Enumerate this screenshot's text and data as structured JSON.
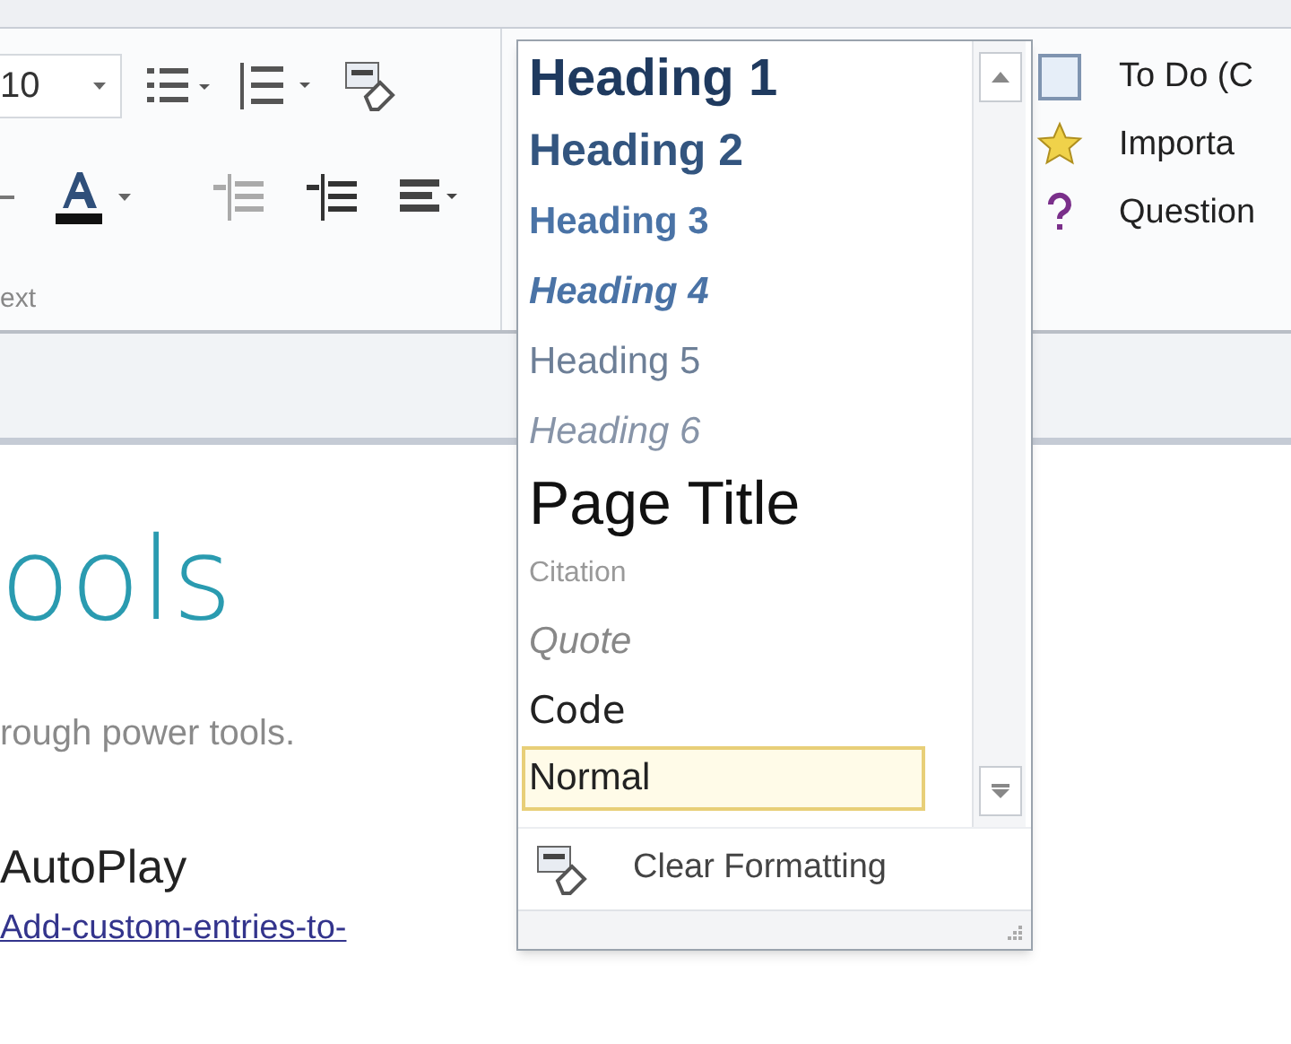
{
  "ribbon": {
    "font_size": "10",
    "group_label": "ext"
  },
  "styles_gallery": {
    "styles": [
      {
        "label": "Heading 1",
        "kind": "h1",
        "selected": false
      },
      {
        "label": "Heading 2",
        "kind": "h2",
        "selected": false
      },
      {
        "label": "Heading 3",
        "kind": "h3",
        "selected": false
      },
      {
        "label": "Heading 4",
        "kind": "h4",
        "selected": false
      },
      {
        "label": "Heading 5",
        "kind": "h5",
        "selected": false
      },
      {
        "label": "Heading 6",
        "kind": "h6",
        "selected": false
      },
      {
        "label": "Page Title",
        "kind": "title",
        "selected": false
      },
      {
        "label": "Citation",
        "kind": "citation",
        "selected": false
      },
      {
        "label": "Quote",
        "kind": "quote",
        "selected": false
      },
      {
        "label": "Code",
        "kind": "code",
        "selected": false
      },
      {
        "label": "Normal",
        "kind": "normal",
        "selected": true
      }
    ],
    "clear_formatting": "Clear Formatting"
  },
  "tags": [
    {
      "label": "To Do (C",
      "kind": "checkbox"
    },
    {
      "label": "Importa",
      "kind": "star"
    },
    {
      "label": "Question",
      "kind": "question"
    }
  ],
  "page": {
    "title": "ools",
    "subtitle": "rough power tools.",
    "heading": "AutoPlay",
    "link": "Add-custom-entries-to-"
  }
}
